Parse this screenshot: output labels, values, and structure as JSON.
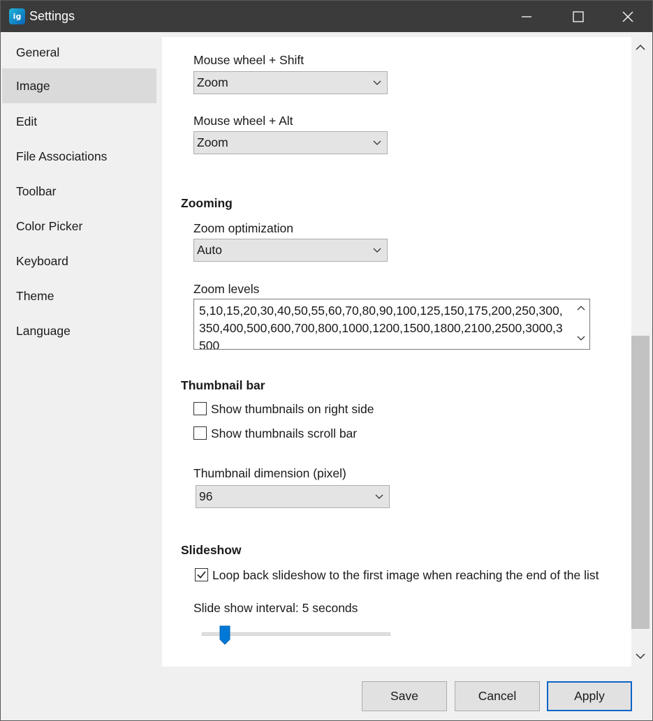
{
  "window": {
    "title": "Settings",
    "app_icon": "imageglass-app-icon",
    "controls": [
      "minimize-icon",
      "maximize-icon",
      "close-icon"
    ]
  },
  "sidebar": {
    "items": [
      {
        "label": "General",
        "active": false
      },
      {
        "label": "Image",
        "active": true
      },
      {
        "label": "Edit",
        "active": false
      },
      {
        "label": "File Associations",
        "active": false
      },
      {
        "label": "Toolbar",
        "active": false
      },
      {
        "label": "Color Picker",
        "active": false
      },
      {
        "label": "Keyboard",
        "active": false
      },
      {
        "label": "Theme",
        "active": false
      },
      {
        "label": "Language",
        "active": false
      }
    ]
  },
  "mouse_wheel": {
    "shift_label": "Mouse wheel + Shift",
    "shift_value": "Zoom",
    "alt_label": "Mouse wheel + Alt",
    "alt_value": "Zoom"
  },
  "zooming": {
    "heading": "Zooming",
    "optimization_label": "Zoom optimization",
    "optimization_value": "Auto",
    "levels_label": "Zoom levels",
    "levels_value": "5,10,15,20,30,40,50,55,60,70,80,90,100,125,150,175,200,250,300,350,400,500,600,700,800,1000,1200,1500,1800,2100,2500,3000,3500"
  },
  "thumbnail_bar": {
    "heading": "Thumbnail bar",
    "right_side_label": "Show thumbnails on right side",
    "right_side_checked": false,
    "scroll_bar_label": "Show thumbnails scroll bar",
    "scroll_bar_checked": false,
    "dimension_label": "Thumbnail dimension (pixel)",
    "dimension_value": "96"
  },
  "slideshow": {
    "heading": "Slideshow",
    "loop_label": "Loop back slideshow to the first image when reaching the end of the list",
    "loop_checked": true,
    "interval_label": "Slide show interval: 5 seconds",
    "interval_fraction": 0.1
  },
  "footer": {
    "save_label": "Save",
    "cancel_label": "Cancel",
    "apply_label": "Apply"
  },
  "colors": {
    "titlebar": "#3b3b3b",
    "accent": "#0a64c8",
    "slider_thumb": "#0078d7"
  }
}
